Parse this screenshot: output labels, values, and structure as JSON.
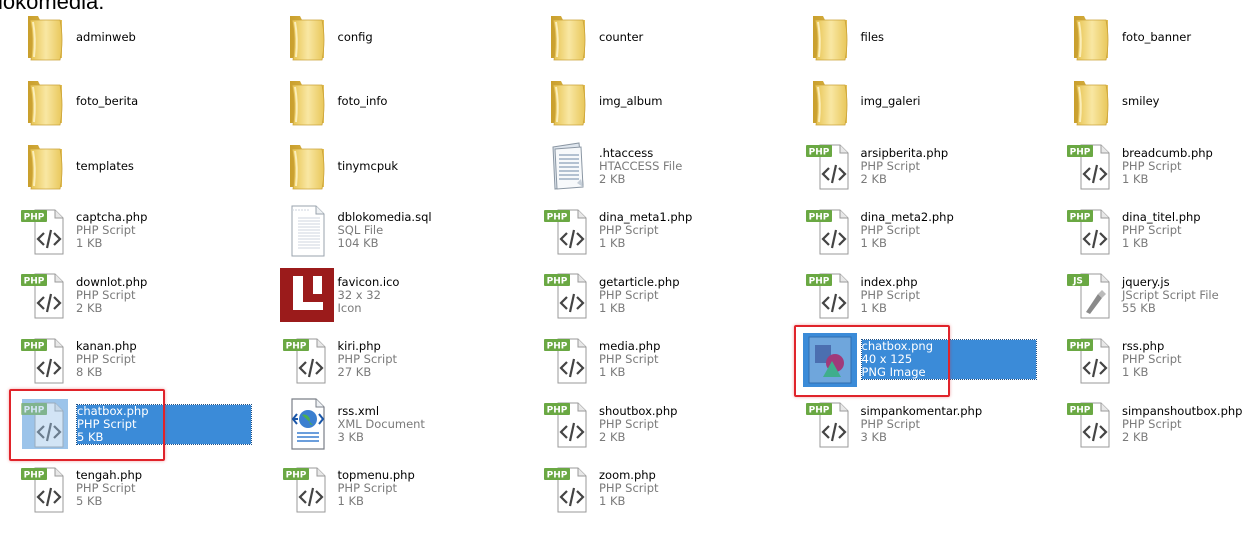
{
  "caption": "lokomedia:",
  "colors": {
    "selection": "#3b8bd8",
    "highlight": "#e0232a",
    "php_badge": "#6aa843"
  },
  "items": [
    {
      "name": "adminweb",
      "type": "folder"
    },
    {
      "name": "config",
      "type": "folder"
    },
    {
      "name": "counter",
      "type": "folder"
    },
    {
      "name": "files",
      "type": "folder"
    },
    {
      "name": "foto_banner",
      "type": "folder"
    },
    {
      "name": "foto_berita",
      "type": "folder"
    },
    {
      "name": "foto_info",
      "type": "folder"
    },
    {
      "name": "img_album",
      "type": "folder"
    },
    {
      "name": "img_galeri",
      "type": "folder"
    },
    {
      "name": "smiley",
      "type": "folder"
    },
    {
      "name": "templates",
      "type": "folder"
    },
    {
      "name": "tinymcpuk",
      "type": "folder"
    },
    {
      "name": ".htaccess",
      "type": "htaccess",
      "kind": "HTACCESS File",
      "size": "2 KB"
    },
    {
      "name": "arsipberita.php",
      "type": "php",
      "kind": "PHP Script",
      "size": "2 KB"
    },
    {
      "name": "breadcumb.php",
      "type": "php",
      "kind": "PHP Script",
      "size": "1 KB"
    },
    {
      "name": "captcha.php",
      "type": "php",
      "kind": "PHP Script",
      "size": "1 KB"
    },
    {
      "name": "dblokomedia.sql",
      "type": "sql",
      "kind": "SQL File",
      "size": "104 KB"
    },
    {
      "name": "dina_meta1.php",
      "type": "php",
      "kind": "PHP Script",
      "size": "1 KB"
    },
    {
      "name": "dina_meta2.php",
      "type": "php",
      "kind": "PHP Script",
      "size": "1 KB"
    },
    {
      "name": "dina_titel.php",
      "type": "php",
      "kind": "PHP Script",
      "size": "1 KB"
    },
    {
      "name": "downlot.php",
      "type": "php",
      "kind": "PHP Script",
      "size": "2 KB"
    },
    {
      "name": "favicon.ico",
      "type": "ico",
      "kind": "32 x 32",
      "size": "Icon"
    },
    {
      "name": "getarticle.php",
      "type": "php",
      "kind": "PHP Script",
      "size": "1 KB"
    },
    {
      "name": "index.php",
      "type": "php",
      "kind": "PHP Script",
      "size": "1 KB"
    },
    {
      "name": "jquery.js",
      "type": "js",
      "kind": "JScript Script File",
      "size": "55 KB"
    },
    {
      "name": "kanan.php",
      "type": "php",
      "kind": "PHP Script",
      "size": "8 KB"
    },
    {
      "name": "kiri.php",
      "type": "php",
      "kind": "PHP Script",
      "size": "27 KB"
    },
    {
      "name": "media.php",
      "type": "php",
      "kind": "PHP Script",
      "size": "1 KB"
    },
    {
      "name": "chatbox.png",
      "type": "png",
      "kind": "40 x 125",
      "size": "PNG Image",
      "selected": true,
      "highlighted": true
    },
    {
      "name": "rss.php",
      "type": "php",
      "kind": "PHP Script",
      "size": "1 KB"
    },
    {
      "name": "chatbox.php",
      "type": "php",
      "kind": "PHP Script",
      "size": "5 KB",
      "selected": true,
      "highlighted": true
    },
    {
      "name": "rss.xml",
      "type": "xml",
      "kind": "XML Document",
      "size": "3 KB"
    },
    {
      "name": "shoutbox.php",
      "type": "php",
      "kind": "PHP Script",
      "size": "2 KB"
    },
    {
      "name": "simpankomentar.php",
      "type": "php",
      "kind": "PHP Script",
      "size": "3 KB"
    },
    {
      "name": "simpanshoutbox.php",
      "type": "php",
      "kind": "PHP Script",
      "size": "2 KB"
    },
    {
      "name": "tengah.php",
      "type": "php",
      "kind": "PHP Script",
      "size": "5 KB"
    },
    {
      "name": "topmenu.php",
      "type": "php",
      "kind": "PHP Script",
      "size": "1 KB"
    },
    {
      "name": "zoom.php",
      "type": "php",
      "kind": "PHP Script",
      "size": "1 KB"
    }
  ]
}
